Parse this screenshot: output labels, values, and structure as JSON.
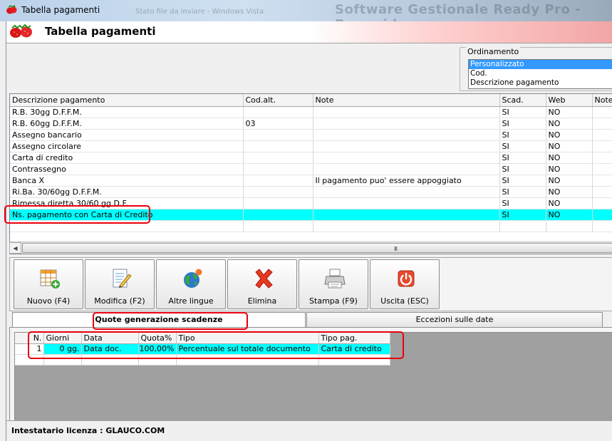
{
  "window": {
    "title": "Tabella pagamenti",
    "background_text_1": "Stato file da inviare - Windows Vista",
    "background_text_2": "Software Gestionale Ready Pro - Pyramid"
  },
  "header": {
    "title": "Tabella pagamenti"
  },
  "ordinamento": {
    "label": "Ordinamento",
    "options": [
      "Personalizzato",
      "Cod.",
      "Descrizione pagamento"
    ],
    "selected": "Personalizzato"
  },
  "payments_table": {
    "columns": [
      "Descrizione pagamento",
      "Cod.alt.",
      "Note",
      "Scad.",
      "Web",
      "Note"
    ],
    "rows": [
      [
        "R.B. 30gg D.F.F.M.",
        "",
        "",
        "SI",
        "NO",
        ""
      ],
      [
        "R.B. 60gg D.F.F.M.",
        "03",
        "",
        "SI",
        "NO",
        ""
      ],
      [
        "Assegno bancario",
        "",
        "",
        "SI",
        "NO",
        ""
      ],
      [
        "Assegno circolare",
        "",
        "",
        "SI",
        "NO",
        ""
      ],
      [
        "Carta di credito",
        "",
        "",
        "SI",
        "NO",
        ""
      ],
      [
        "Contrassegno",
        "",
        "",
        "SI",
        "NO",
        ""
      ],
      [
        "Banca X",
        "",
        "Il pagamento puo' essere appoggiato",
        "SI",
        "NO",
        ""
      ],
      [
        "Ri.Ba. 30/60gg D.F.F.M.",
        "",
        "",
        "SI",
        "NO",
        ""
      ],
      [
        "Rimessa diretta 30/60 gg D.F.",
        "",
        "",
        "SI",
        "NO",
        ""
      ],
      [
        "Ns. pagamento con Carta di Credito",
        "",
        "",
        "SI",
        "NO",
        ""
      ]
    ],
    "selected_row": 9
  },
  "scrollbar": {
    "grip": "III"
  },
  "toolbar": {
    "buttons": [
      {
        "label": "Nuovo (F4)"
      },
      {
        "label": "Modifica (F2)"
      },
      {
        "label": "Altre lingue"
      },
      {
        "label": "Elimina"
      },
      {
        "label": "Stampa (F9)"
      },
      {
        "label": "Uscita (ESC)"
      }
    ]
  },
  "tabs": [
    {
      "label": "Quote generazione scadenze",
      "active": true
    },
    {
      "label": "Eccezioni sulle date",
      "active": false
    }
  ],
  "quote_table": {
    "columns": [
      "N.",
      "Giorni",
      "Data",
      "Quota%",
      "Tipo",
      "Tipo pag."
    ],
    "rows": [
      [
        "1",
        "0 gg.",
        "Data doc.",
        "100,00%",
        "Percentuale sul totale documento",
        "Carta di credito"
      ]
    ]
  },
  "status": {
    "text": "Intestatario licenza : GLAUCO.COM"
  },
  "colors": {
    "selection": "#00ffff",
    "list_selection": "#3399ff",
    "annotation": "#e8000b"
  }
}
